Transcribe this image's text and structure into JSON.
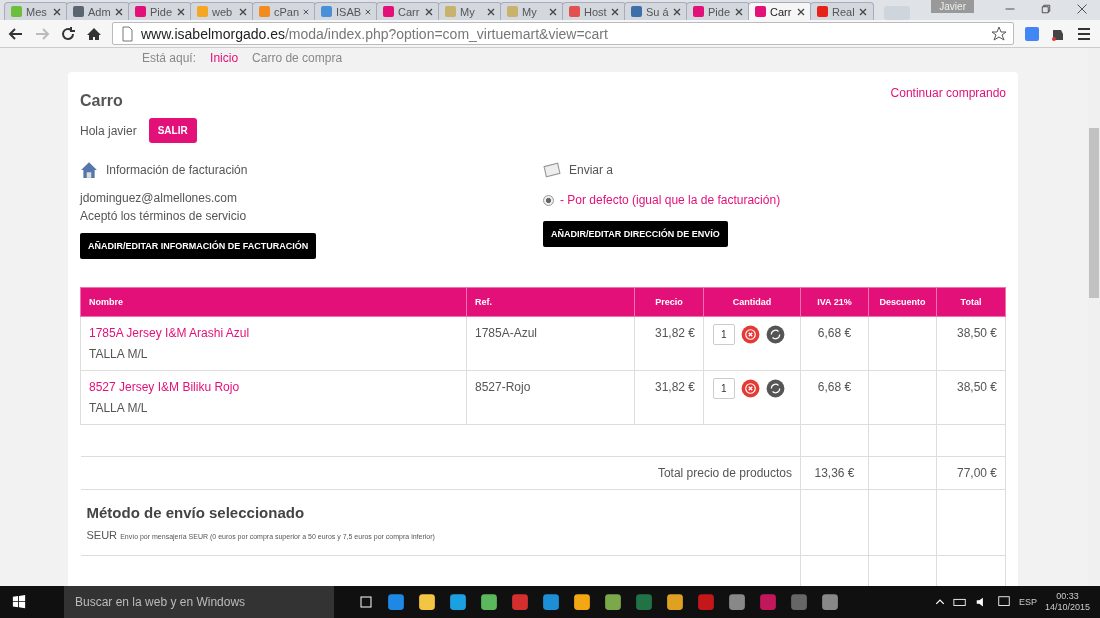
{
  "browser": {
    "tabs": [
      {
        "label": "Mes",
        "selected": false,
        "color": "#6cbf3c"
      },
      {
        "label": "Adm",
        "selected": false,
        "color": "#5a6570"
      },
      {
        "label": "Pide",
        "selected": false,
        "color": "#e3107a"
      },
      {
        "label": "web",
        "selected": false,
        "color": "#f5a623"
      },
      {
        "label": "cPan",
        "selected": false,
        "color": "#f28c1e"
      },
      {
        "label": "ISAB",
        "selected": false,
        "color": "#4a90d9"
      },
      {
        "label": "Carr",
        "selected": false,
        "color": "#e3107a"
      },
      {
        "label": "My",
        "selected": false,
        "color": "#c9b26b"
      },
      {
        "label": "My",
        "selected": false,
        "color": "#c9b26b"
      },
      {
        "label": "Host",
        "selected": false,
        "color": "#e25050"
      },
      {
        "label": "Su á",
        "selected": false,
        "color": "#3d6fa8"
      },
      {
        "label": "Pide",
        "selected": false,
        "color": "#e3107a"
      },
      {
        "label": "Carr",
        "selected": true,
        "color": "#e3107a"
      },
      {
        "label": "Real",
        "selected": false,
        "color": "#e62117"
      }
    ],
    "profile": "Javier",
    "url_host": "www.isabelmorgado.es",
    "url_path": "/moda/index.php?option=com_virtuemart&view=cart"
  },
  "breadcrumb": {
    "label": "Está aquí:",
    "items": [
      "Inicio",
      "Carro de compra"
    ]
  },
  "cart": {
    "title": "Carro",
    "continue_link": "Continuar comprando",
    "greeting": "Hola javier",
    "logout_button": "SALIR",
    "billing": {
      "heading": "Información de facturación",
      "email": "jdominguez@almellones.com",
      "terms": "Aceptó los términos de servicio",
      "button": "AÑADIR/EDITAR INFORMACIÓN DE FACTURACIÓN"
    },
    "shipping": {
      "heading": "Enviar a",
      "option": "- Por defecto (igual que la de facturación)",
      "option_selected": true,
      "button": "AÑADIR/EDITAR DIRECCIÓN DE ENVÍO"
    },
    "table": {
      "columns": [
        "Nombre",
        "Ref.",
        "Precio",
        "Cantidad",
        "IVA 21%",
        "Descuento",
        "Total"
      ],
      "rows": [
        {
          "name": "1785A Jersey I&M Arashi Azul",
          "variant": "TALLA M/L",
          "ref": "1785A-Azul",
          "price": "31,82 €",
          "quantity": "1",
          "tax": "6,68 €",
          "total": "38,50 €"
        },
        {
          "name": "8527 Jersey I&M Biliku Rojo",
          "variant": "TALLA M/L",
          "ref": "8527-Rojo",
          "price": "31,82 €",
          "quantity": "1",
          "tax": "6,68 €",
          "total": "38,50 €"
        }
      ],
      "subtotal": {
        "label": "Total precio de productos",
        "tax": "13,36 €",
        "total": "77,00 €"
      }
    },
    "shipment": {
      "heading": "Método de envío seleccionado",
      "carrier": "SEUR",
      "description": "Envío por mensajería SEUR (0 euros por compra superior a 50 euros y 7,5 euros por compra inferior)"
    }
  },
  "taskbar": {
    "search_placeholder": "Buscar en la web y en Windows",
    "language": "ESP",
    "time": "00:33",
    "date": "14/10/2015"
  }
}
